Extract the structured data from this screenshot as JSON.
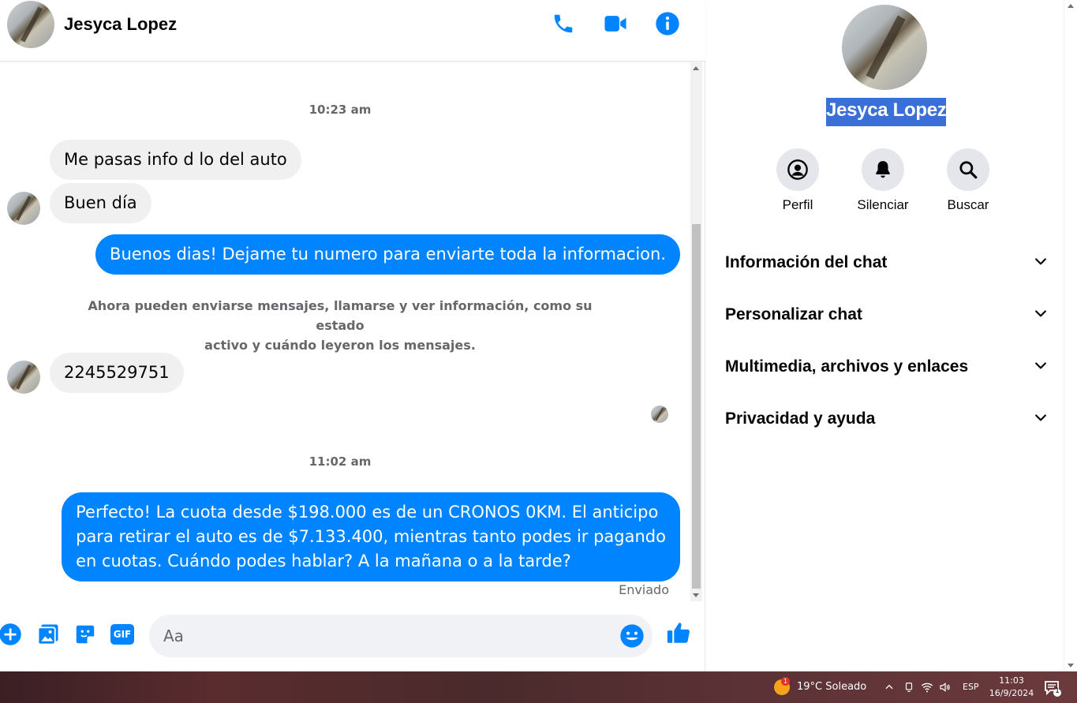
{
  "header": {
    "contact_name": "Jesyca Lopez",
    "accent_color": "#0084ff",
    "icons": [
      "phone-icon",
      "video-icon",
      "info-icon"
    ]
  },
  "messages": {
    "timestamp_1": "10:23 am",
    "msg_1": "Me pasas info d lo del auto",
    "msg_2": "Buen día",
    "msg_3": "Buenos dias! Dejame tu numero para enviarte toda la informacion.",
    "system_note_line1": "Ahora pueden enviarse mensajes, llamarse y ver información, como su estado",
    "system_note_line2": "activo y cuándo leyeron los mensajes.",
    "msg_4": "2245529751",
    "timestamp_2": "11:02 am",
    "msg_5_line1": "Perfecto! La cuota desde $198.000 es de un CRONOS 0KM. El anticipo",
    "msg_5_line2": "para retirar el auto es de $7.133.400, mientras tanto podes ir pagando",
    "msg_5_line3": "en cuotas. Cuándo podes hablar? A la mañana o a la tarde?",
    "sent_status": "Enviado"
  },
  "composer": {
    "placeholder": "Aa",
    "icons": [
      "plus-icon",
      "image-icon",
      "sticker-icon",
      "gif-icon",
      "emoji-icon",
      "like-icon"
    ],
    "gif_label": "GIF"
  },
  "sidebar": {
    "name": "Jesyca Lopez",
    "actions": [
      {
        "label": "Perfil",
        "icon": "profile-icon"
      },
      {
        "label": "Silenciar",
        "icon": "bell-icon"
      },
      {
        "label": "Buscar",
        "icon": "search-icon"
      }
    ],
    "sections": [
      {
        "label": "Información del chat"
      },
      {
        "label": "Personalizar chat"
      },
      {
        "label": "Multimedia, archivos y enlaces"
      },
      {
        "label": "Privacidad y ayuda"
      }
    ]
  },
  "taskbar": {
    "weather_badge": "1",
    "weather": "19°C  Soleado",
    "language": "ESP",
    "time": "11:03",
    "date": "16/9/2024",
    "notifications_count": "1"
  }
}
